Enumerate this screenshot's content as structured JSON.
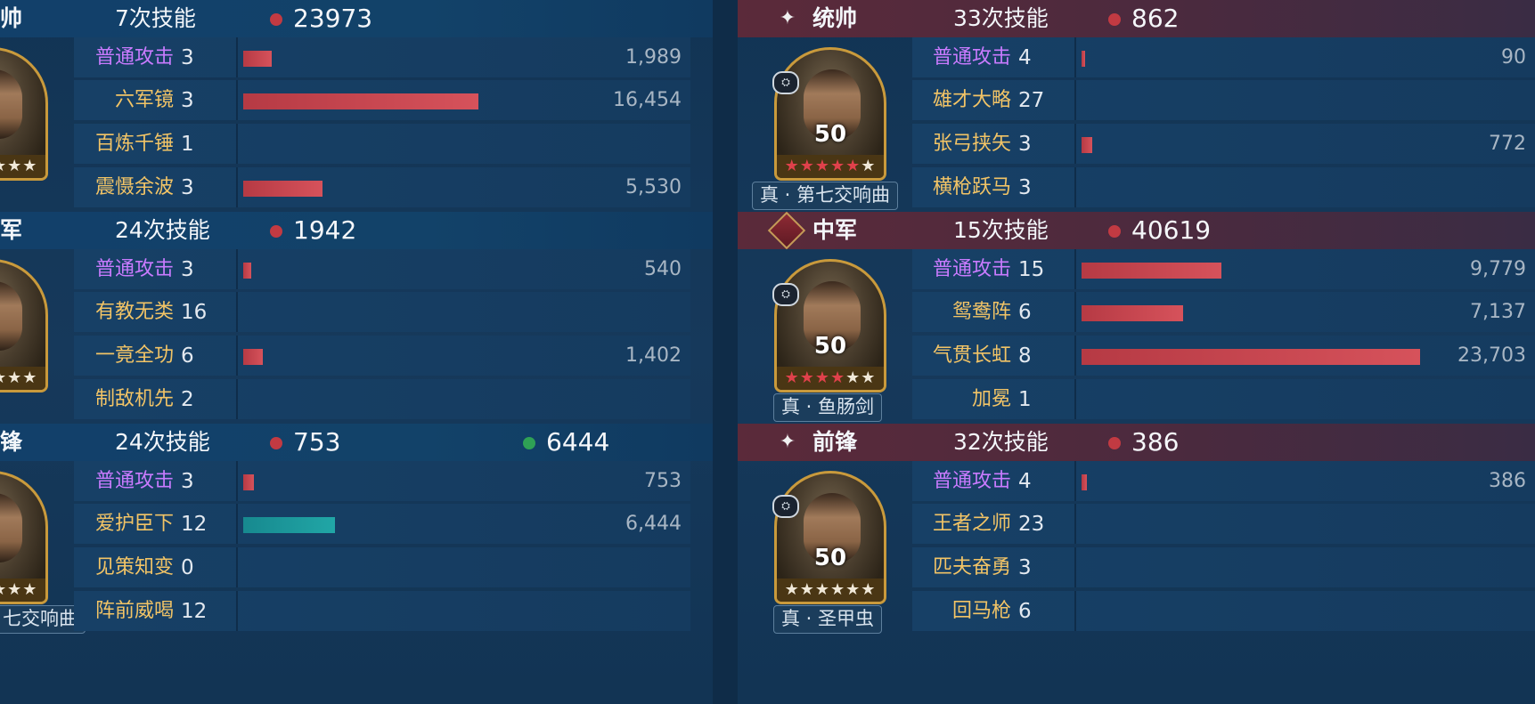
{
  "left": {
    "sections": [
      {
        "role": "帅",
        "skill_count": "7次技能",
        "red_total": "23973",
        "skills": [
          {
            "name": "普通攻击",
            "name_color": "purple",
            "count": "3",
            "value": "1,989",
            "bar_fraction": 0.0839,
            "bar_color": "red"
          },
          {
            "name": "六军镜",
            "name_color": "gold",
            "count": "3",
            "value": "16,454",
            "bar_fraction": 0.694,
            "bar_color": "red"
          },
          {
            "name": "百炼千锤",
            "name_color": "gold",
            "count": "1",
            "value": "",
            "bar_fraction": 0,
            "bar_color": "red"
          },
          {
            "name": "震慑余波",
            "name_color": "gold",
            "count": "3",
            "value": "5,530",
            "bar_fraction": 0.2333,
            "bar_color": "red"
          }
        ]
      },
      {
        "role": "军",
        "skill_count": "24次技能",
        "red_total": "1942",
        "skills": [
          {
            "name": "普通攻击",
            "name_color": "purple",
            "count": "3",
            "value": "540",
            "bar_fraction": 0.0228,
            "bar_color": "red"
          },
          {
            "name": "有教无类",
            "name_color": "gold",
            "count": "16",
            "value": "",
            "bar_fraction": 0,
            "bar_color": "red"
          },
          {
            "name": "一竟全功",
            "name_color": "gold",
            "count": "6",
            "value": "1,402",
            "bar_fraction": 0.0591,
            "bar_color": "red"
          },
          {
            "name": "制敌机先",
            "name_color": "gold",
            "count": "2",
            "value": "",
            "bar_fraction": 0,
            "bar_color": "red"
          }
        ]
      },
      {
        "role": "锋",
        "skill_count": "24次技能",
        "red_total": "753",
        "green_total": "6444",
        "weapon": "七交响曲",
        "skills": [
          {
            "name": "普通攻击",
            "name_color": "purple",
            "count": "3",
            "value": "753",
            "bar_fraction": 0.0318,
            "bar_color": "red"
          },
          {
            "name": "爱护臣下",
            "name_color": "gold",
            "count": "12",
            "value": "6,444",
            "bar_fraction": 0.2719,
            "bar_color": "teal"
          },
          {
            "name": "见策知变",
            "name_color": "gold",
            "count": "0",
            "value": "",
            "bar_fraction": 0,
            "bar_color": "red"
          },
          {
            "name": "阵前威喝",
            "name_color": "gold",
            "count": "12",
            "value": "",
            "bar_fraction": 0,
            "bar_color": "red"
          }
        ]
      }
    ]
  },
  "right": {
    "sections": [
      {
        "icon": "star-icon",
        "role": "统帅",
        "skill_count": "33次技能",
        "red_total": "862",
        "level": "50",
        "red_stars": 5,
        "total_stars": 6,
        "weapon": "真 · 第七交响曲",
        "skills": [
          {
            "name": "普通攻击",
            "name_color": "purple",
            "count": "4",
            "value": "90",
            "bar_fraction": 0.0038,
            "bar_color": "red"
          },
          {
            "name": "雄才大略",
            "name_color": "gold",
            "count": "27",
            "value": "",
            "bar_fraction": 0,
            "bar_color": "red"
          },
          {
            "name": "张弓挟矢",
            "name_color": "gold",
            "count": "3",
            "value": "772",
            "bar_fraction": 0.0326,
            "bar_color": "red"
          },
          {
            "name": "横枪跃马",
            "name_color": "gold",
            "count": "3",
            "value": "",
            "bar_fraction": 0,
            "bar_color": "red"
          }
        ]
      },
      {
        "icon": "sword-diamond-icon",
        "role": "中军",
        "skill_count": "15次技能",
        "red_total": "40619",
        "level": "50",
        "red_stars": 4,
        "total_stars": 6,
        "weapon": "真 · 鱼肠剑",
        "skills": [
          {
            "name": "普通攻击",
            "name_color": "purple",
            "count": "15",
            "value": "9,779",
            "bar_fraction": 0.4125,
            "bar_color": "red"
          },
          {
            "name": "鸳鸯阵",
            "name_color": "gold",
            "count": "6",
            "value": "7,137",
            "bar_fraction": 0.3011,
            "bar_color": "red"
          },
          {
            "name": "气贯长虹",
            "name_color": "gold",
            "count": "8",
            "value": "23,703",
            "bar_fraction": 1.0,
            "bar_color": "red"
          },
          {
            "name": "加冕",
            "name_color": "gold",
            "count": "1",
            "value": "",
            "bar_fraction": 0,
            "bar_color": "red"
          }
        ]
      },
      {
        "icon": "star-icon",
        "role": "前锋",
        "skill_count": "32次技能",
        "red_total": "386",
        "level": "50",
        "red_stars": 0,
        "total_stars": 6,
        "weapon": "真 · 圣甲虫",
        "skills": [
          {
            "name": "普通攻击",
            "name_color": "purple",
            "count": "4",
            "value": "386",
            "bar_fraction": 0.0163,
            "bar_color": "red"
          },
          {
            "name": "王者之师",
            "name_color": "gold",
            "count": "23",
            "value": "",
            "bar_fraction": 0,
            "bar_color": "red"
          },
          {
            "name": "匹夫奋勇",
            "name_color": "gold",
            "count": "3",
            "value": "",
            "bar_fraction": 0,
            "bar_color": "red"
          },
          {
            "name": "回马枪",
            "name_color": "gold",
            "count": "6",
            "value": "",
            "bar_fraction": 0,
            "bar_color": "red"
          }
        ]
      }
    ]
  },
  "colors": {
    "red_bar": "#c8444d",
    "teal_bar": "#1e9ea0",
    "purple_skill": "#c97bff",
    "gold_skill": "#f2c466"
  }
}
